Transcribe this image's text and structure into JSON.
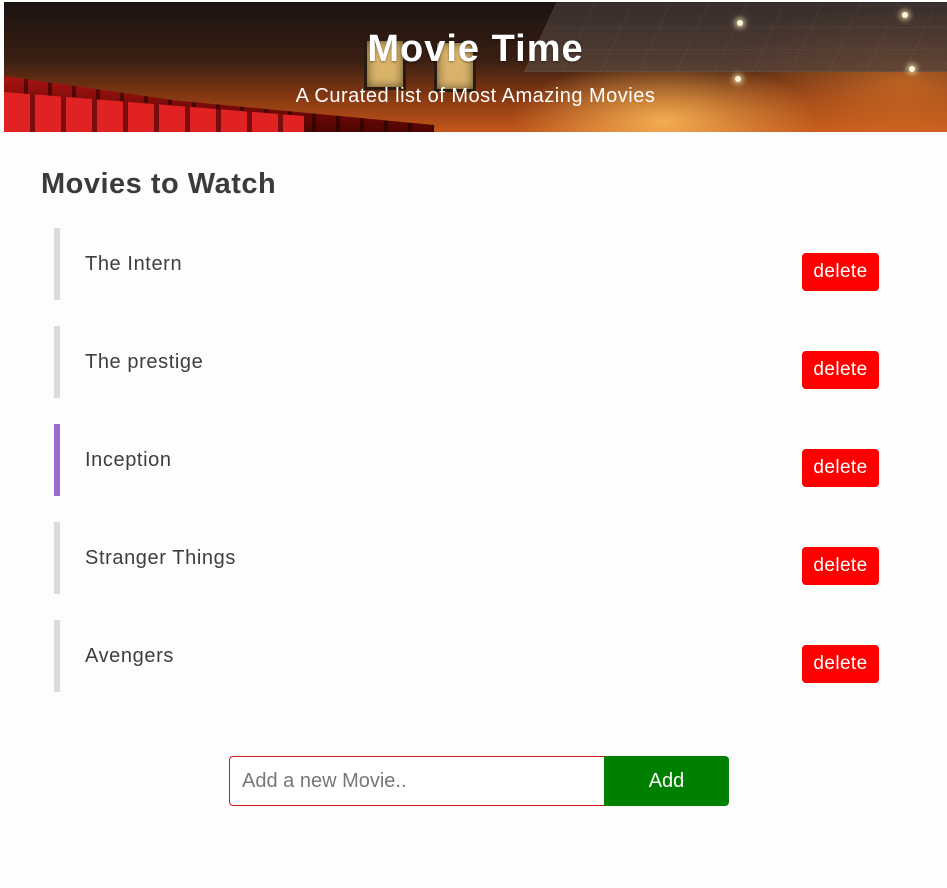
{
  "header": {
    "title": "Movie Time",
    "subtitle": "A Curated list of Most Amazing Movies"
  },
  "section": {
    "title": "Movies to Watch"
  },
  "movies": [
    {
      "title": "The Intern",
      "delete_label": "delete",
      "highlighted": false
    },
    {
      "title": "The prestige",
      "delete_label": "delete",
      "highlighted": false
    },
    {
      "title": "Inception",
      "delete_label": "delete",
      "highlighted": true
    },
    {
      "title": "Stranger Things",
      "delete_label": "delete",
      "highlighted": false
    },
    {
      "title": "Avengers",
      "delete_label": "delete",
      "highlighted": false
    }
  ],
  "add_form": {
    "placeholder": "Add a new Movie..",
    "value": "",
    "button_label": "Add"
  },
  "colors": {
    "delete_button": "#ff0000",
    "add_button": "#008000",
    "highlight_border": "#9b6bd0",
    "default_border": "#dcdcdc",
    "input_border": "#d01c1c"
  }
}
